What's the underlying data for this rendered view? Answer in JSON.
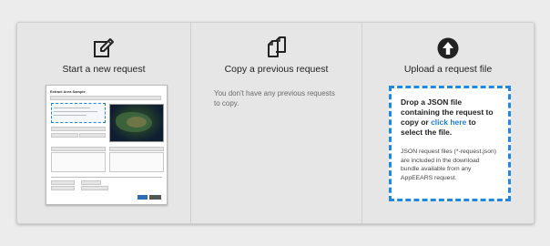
{
  "options": {
    "new": {
      "title": "Start a new request",
      "icon": "edit-icon"
    },
    "copy": {
      "title": "Copy a previous request",
      "icon": "copy-icon",
      "empty_message": "You don't have any previous requests to copy."
    },
    "upload": {
      "title": "Upload a request file",
      "icon": "upload-circle-icon",
      "drop_prefix": "Drop a JSON file containing the request to copy or ",
      "drop_link": "click here",
      "drop_suffix": " to select the file.",
      "note": "JSON request files (*-request.json) are included in the download bundle available from any AppEEARS request."
    }
  },
  "preview": {
    "title": "Extract Area Sample"
  },
  "colors": {
    "accent": "#1e88e5",
    "link": "#1f7dd6",
    "panel_bg": "#e6e6e6"
  }
}
